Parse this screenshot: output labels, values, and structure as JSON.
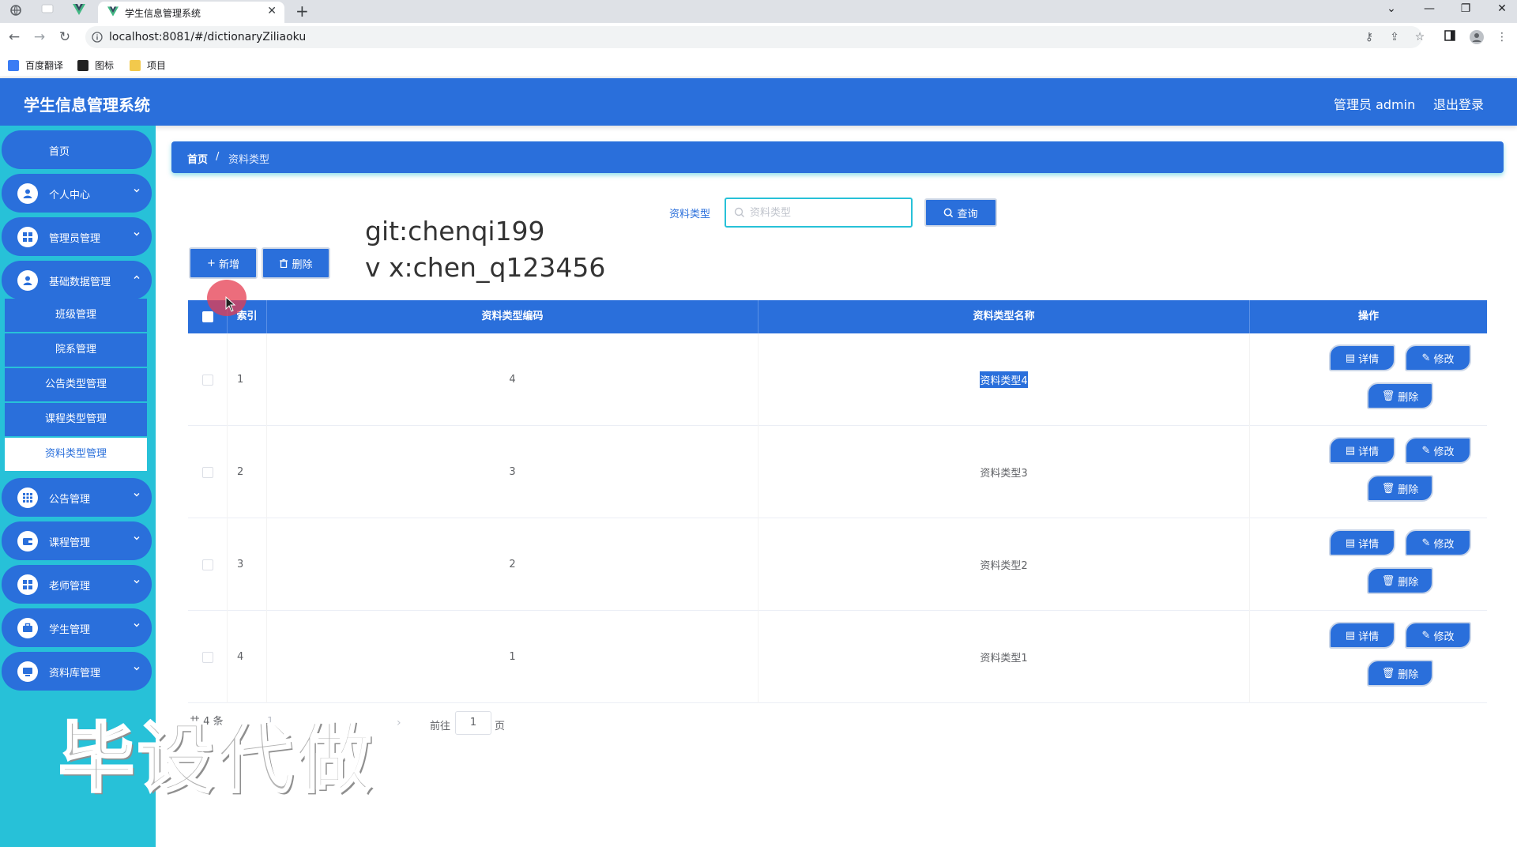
{
  "browser": {
    "tab_title": "学生信息管理系统",
    "url": "localhost:8081/#/dictionaryZiliaoku",
    "bookmarks": [
      "百度翻译",
      "图标",
      "项目"
    ]
  },
  "header": {
    "title": "学生信息管理系统",
    "user": "管理员 admin",
    "logout": "退出登录"
  },
  "sidebar": {
    "home": "首页",
    "menus": [
      {
        "label": "个人中心",
        "icon": "user-icon"
      },
      {
        "label": "管理员管理",
        "icon": "grid-icon"
      },
      {
        "label": "基础数据管理",
        "icon": "user-icon"
      },
      {
        "label": "公告管理",
        "icon": "apps-icon"
      },
      {
        "label": "课程管理",
        "icon": "wallet-icon"
      },
      {
        "label": "老师管理",
        "icon": "grid-icon"
      },
      {
        "label": "学生管理",
        "icon": "briefcase-icon"
      },
      {
        "label": "资料库管理",
        "icon": "monitor-icon"
      }
    ],
    "submenus": [
      "班级管理",
      "院系管理",
      "公告类型管理",
      "课程类型管理",
      "资料类型管理"
    ],
    "active_submenu": "资料类型管理"
  },
  "breadcrumb": {
    "home": "首页",
    "separator": "/",
    "current": "资料类型"
  },
  "search": {
    "label": "资料类型",
    "placeholder": "资料类型",
    "value": "",
    "button": "查询"
  },
  "actions": {
    "add": "新增",
    "delete": "删除"
  },
  "overlay_text": {
    "line1": "git:chenqi199",
    "line2": "v x:chen_q123456",
    "watermark": "毕设代做"
  },
  "table": {
    "headers": {
      "index": "索引",
      "code": "资料类型编码",
      "name": "资料类型名称",
      "ops": "操作"
    },
    "rows": [
      {
        "index": "1",
        "code": "4",
        "name": "资料类型4"
      },
      {
        "index": "2",
        "code": "3",
        "name": "资料类型3"
      },
      {
        "index": "3",
        "code": "2",
        "name": "资料类型2"
      },
      {
        "index": "4",
        "code": "1",
        "name": "资料类型1"
      }
    ],
    "op_labels": {
      "detail": "详情",
      "edit": "修改",
      "delete": "删除"
    }
  },
  "pagination": {
    "total_prefix": "共 4 条",
    "page": "1",
    "goto": "前往",
    "page_input": "1",
    "page_suffix": "页"
  },
  "colors": {
    "primary": "#2a6fdb",
    "sidebar": "#27c1d8"
  }
}
